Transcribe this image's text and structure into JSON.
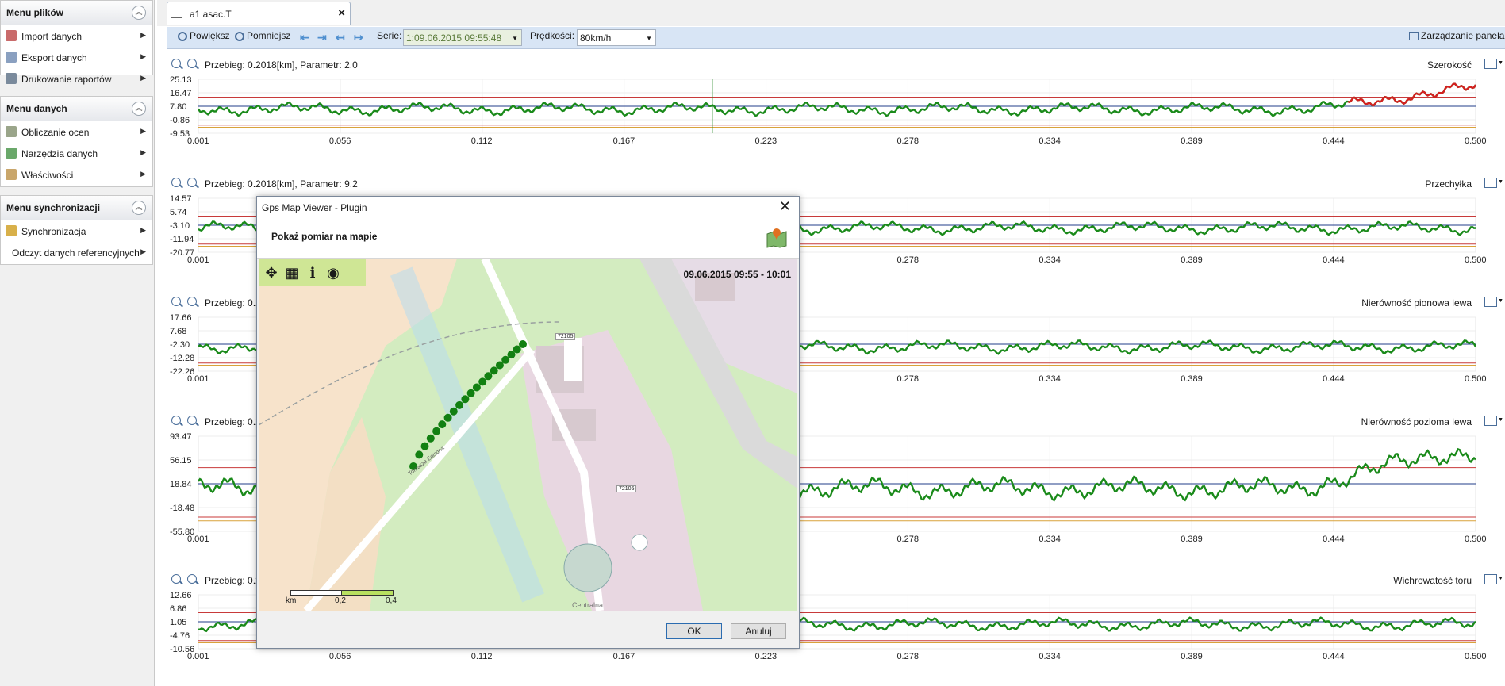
{
  "sidebar": {
    "panels": [
      {
        "title": "Menu plików",
        "items": [
          "Import danych",
          "Eksport danych",
          "Drukowanie raportów"
        ]
      },
      {
        "title": "Menu danych",
        "items": [
          "Obliczanie ocen",
          "Narzędzia danych",
          "Właściwości"
        ]
      },
      {
        "title": "Menu synchronizacji",
        "items": [
          "Synchronizacja",
          "Odczyt danych referencyjnych"
        ]
      }
    ]
  },
  "tab": {
    "label": "a1 asac.T"
  },
  "toolbar": {
    "zoom_in": "Powiększ",
    "zoom_out": "Pomniejsz",
    "serie_label": "Serie:",
    "serie_value": "1:09.06.2015 09:55:48",
    "speed_label": "Prędkości:",
    "speed_value": "80km/h",
    "panel_manager": "Zarządzanie panelami"
  },
  "colors": {
    "series_main": "#1a8a1a",
    "series_alert": "#d42020",
    "series_warn": "#e08a00",
    "series_ref": "#203c8a",
    "limit_red": "#c83a3a",
    "limit_orange": "#d9a23a",
    "cursor": "#2a8a2a"
  },
  "x_ticks": [
    "0.001",
    "0.056",
    "0.112",
    "0.167",
    "0.223",
    "0.278",
    "0.334",
    "0.389",
    "0.444",
    "0.500"
  ],
  "charts": [
    {
      "info": "Przebieg: 0.2018[km],   Parametr: 2.0",
      "param": "Szerokość",
      "y_ticks": [
        "25.13",
        "16.47",
        "7.80",
        "-0.86",
        "-9.53"
      ]
    },
    {
      "info": "Przebieg: 0.2018[km],   Parametr: 9.2",
      "param": "Przechyłka",
      "y_ticks": [
        "14.57",
        "5.74",
        "-3.10",
        "-11.94",
        "-20.77"
      ]
    },
    {
      "info": "Przebieg: 0.2",
      "param": "Nierówność pionowa lewa",
      "y_ticks": [
        "17.66",
        "7.68",
        "-2.30",
        "-12.28",
        "-22.26"
      ]
    },
    {
      "info": "Przebieg: 0.2",
      "param": "Nierówność pozioma lewa",
      "y_ticks": [
        "93.47",
        "56.15",
        "18.84",
        "-18.48",
        "-55.80"
      ]
    },
    {
      "info": "Przebieg: 0.2",
      "param": "Wichrowatość toru",
      "y_ticks": [
        "12.66",
        "6.86",
        "1.05",
        "-4.76",
        "-10.56"
      ]
    }
  ],
  "dialog": {
    "title": "Gps Map Viewer - Plugin",
    "heading": "Pokaż pomiar na mapie",
    "map_datetime": "09.06.2015   09:55 - 10:01",
    "road_labels": [
      "72105",
      "72105",
      "Tomasza Edisona",
      "Centralna"
    ],
    "scale_labels": [
      "km",
      "0,2",
      "0,4"
    ],
    "ok": "OK",
    "cancel": "Anuluj"
  }
}
